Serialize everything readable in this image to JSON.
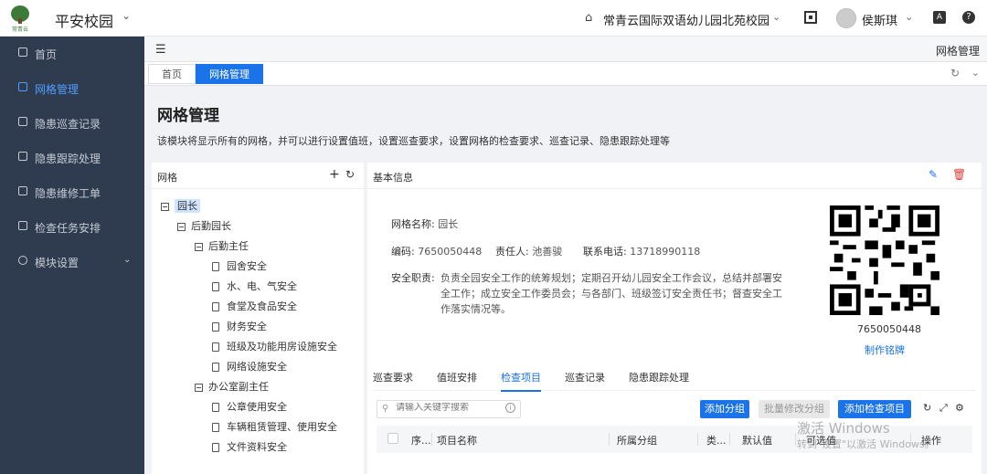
{
  "topbar": {
    "logo_text": "常青云",
    "app_title": "平安校园",
    "school_name": "常青云国际双语幼儿园北苑校园",
    "user_name": "侯斯琪",
    "translate_icon_text": "A"
  },
  "sidebar": {
    "items": [
      {
        "label": "首页",
        "icon": "monitor-icon"
      },
      {
        "label": "网格管理",
        "icon": "grid-icon"
      },
      {
        "label": "隐患巡查记录",
        "icon": "record-icon"
      },
      {
        "label": "隐患跟踪处理",
        "icon": "track-icon"
      },
      {
        "label": "隐患维修工单",
        "icon": "repair-icon"
      },
      {
        "label": "检查任务安排",
        "icon": "task-icon"
      },
      {
        "label": "模块设置",
        "icon": "gear-icon"
      }
    ]
  },
  "subbar": {
    "breadcrumb": "网格管理"
  },
  "tabs": [
    {
      "label": "首页"
    },
    {
      "label": "网格管理"
    }
  ],
  "page": {
    "title": "网格管理",
    "description": "该模块将显示所有的网格，并可以进行设置值班，设置巡查要求，设置网格的检查要求、巡查记录、隐患跟踪处理等"
  },
  "tree": {
    "title": "网格",
    "nodes": [
      {
        "label": "园长",
        "type": "folder"
      },
      {
        "label": "后勤园长",
        "type": "folder"
      },
      {
        "label": "后勤主任",
        "type": "folder"
      },
      {
        "label": "园舍安全",
        "type": "doc"
      },
      {
        "label": "水、电、气安全",
        "type": "doc"
      },
      {
        "label": "食堂及食品安全",
        "type": "doc"
      },
      {
        "label": "财务安全",
        "type": "doc"
      },
      {
        "label": "班级及功能用房设施安全",
        "type": "doc"
      },
      {
        "label": "网络设施安全",
        "type": "doc"
      },
      {
        "label": "办公室副主任",
        "type": "folder"
      },
      {
        "label": "公章使用安全",
        "type": "doc"
      },
      {
        "label": "车辆租赁管理、使用安全",
        "type": "doc"
      },
      {
        "label": "文件资料安全",
        "type": "doc"
      }
    ]
  },
  "info": {
    "title": "基本信息",
    "grid_name_label": "网格名称:",
    "grid_name": "园长",
    "code_label": "编码:",
    "code": "7650050448",
    "owner_label": "责任人:",
    "owner": "池善骏",
    "phone_label": "联系电话:",
    "phone": "13718990118",
    "duty_label": "安全职责:",
    "duty": "负责全园安全工作的统筹规划；定期召开幼儿园安全工作会议，总结并部署安全工作；成立安全工作委员会；与各部门、班级签订安全责任书；督查安全工作落实情况等。",
    "qr_code_text": "7650050448",
    "qr_link": "制作铭牌"
  },
  "inner_tabs": [
    {
      "label": "巡查要求"
    },
    {
      "label": "值班安排"
    },
    {
      "label": "检查项目"
    },
    {
      "label": "巡查记录"
    },
    {
      "label": "隐患跟踪处理"
    }
  ],
  "toolbar": {
    "search_placeholder": "请输入关键字搜索",
    "add_group": "添加分组",
    "batch_edit": "批量修改分组",
    "add_item": "添加检查项目"
  },
  "table": {
    "headers": [
      "序...",
      "项目名称",
      "所属分组",
      "类...",
      "默认值",
      "可选值",
      "操作"
    ]
  },
  "watermark": {
    "line1": "激活 Windows",
    "line2": "转到\"设置\"以激活 Windows。"
  },
  "colors": {
    "primary": "#1a73e8",
    "sidebar_bg": "#2f3c4f",
    "danger": "#e53935"
  }
}
